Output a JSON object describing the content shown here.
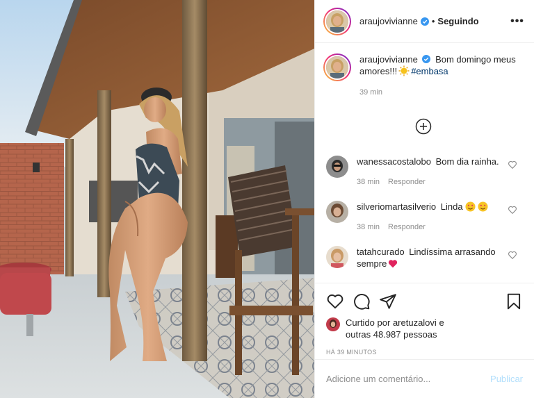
{
  "post": {
    "username": "araujovivianne",
    "separator": "•",
    "follow_status": "Seguindo",
    "more_label": "•••"
  },
  "caption": {
    "username": "araujovivianne",
    "text": "Bom domingo meus amores!!!",
    "emoji": "sun-emoji",
    "hashtag": "#embasa",
    "time": "39 min"
  },
  "load_more_icon": "plus-circle-icon",
  "comments": [
    {
      "username": "wanessacostalobo",
      "text": "Bom dia rainha.",
      "time": "38 min",
      "reply": "Responder"
    },
    {
      "username": "silveriomartasilverio",
      "text": "Linda",
      "time": "38 min",
      "reply": "Responder"
    },
    {
      "username": "tatahcurado",
      "text": "Lindíssima arrasando sempre",
      "time": "",
      "reply": ""
    }
  ],
  "actions": {
    "like_icon": "heart-icon",
    "comment_icon": "comment-icon",
    "share_icon": "paper-plane-icon",
    "save_icon": "bookmark-icon"
  },
  "likes": {
    "prefix": "Curtido por",
    "liker": "aretuzalovi",
    "middle": "e",
    "others": "outras 48.987 pessoas"
  },
  "timestamp": "HÁ 39 MINUTOS",
  "comment_box": {
    "placeholder": "Adicione um comentário...",
    "publish_label": "Publicar"
  },
  "colors": {
    "verified": "#3897f0",
    "link": "#00376b",
    "muted": "#8e8e8e",
    "publish_disabled": "#b2dffc"
  }
}
